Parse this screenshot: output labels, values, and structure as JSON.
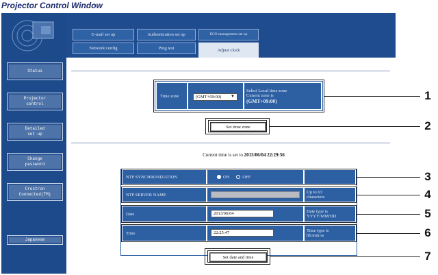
{
  "window": {
    "title": "Projector Control Window"
  },
  "sidebar": {
    "items": [
      {
        "label": "Status"
      },
      {
        "label": "Projector\ncontrol"
      },
      {
        "label": "Detailed\nset up"
      },
      {
        "label": "Change\npassword"
      },
      {
        "label": "Crestron\nConnected(TM)"
      },
      {
        "label": "Japanese"
      }
    ]
  },
  "tabs": {
    "row1": [
      {
        "label": "E-mail set up"
      },
      {
        "label": "Authentication set up"
      },
      {
        "label": "ECO management set up"
      }
    ],
    "row2": [
      {
        "label": "Network config"
      },
      {
        "label": "Ping test"
      },
      {
        "label": "Adjust clock"
      }
    ]
  },
  "timezone": {
    "label": "Time zone",
    "selected": "(GMT+09:00)",
    "hint_line1": "Select Local time zone",
    "hint_line2": "Current zone is",
    "current": "(GMT+09:00)",
    "button": "Set time zone"
  },
  "clock": {
    "current_time_prefix": "Current time is set to",
    "current_time_value": "2013/06/04 22:29:56",
    "ntp_sync_label": "NTP SYNCHRONIZATION",
    "ntp_on": "ON",
    "ntp_off": "OFF",
    "ntp_server_label": "NTP SERVER NAME",
    "ntp_server_value": "",
    "ntp_server_hint1": "Up to 63",
    "ntp_server_hint2": "characters",
    "date_label": "Date",
    "date_value": "2013/06/04",
    "date_hint1": "Date type is",
    "date_hint2": "YYYY/MM/DD",
    "time_label": "Time",
    "time_value": "22:25:47",
    "time_hint1": "Time type is",
    "time_hint2": "hh:mm:ss",
    "button": "Set date and time"
  },
  "callouts": [
    "1",
    "2",
    "3",
    "4",
    "5",
    "6",
    "7"
  ]
}
